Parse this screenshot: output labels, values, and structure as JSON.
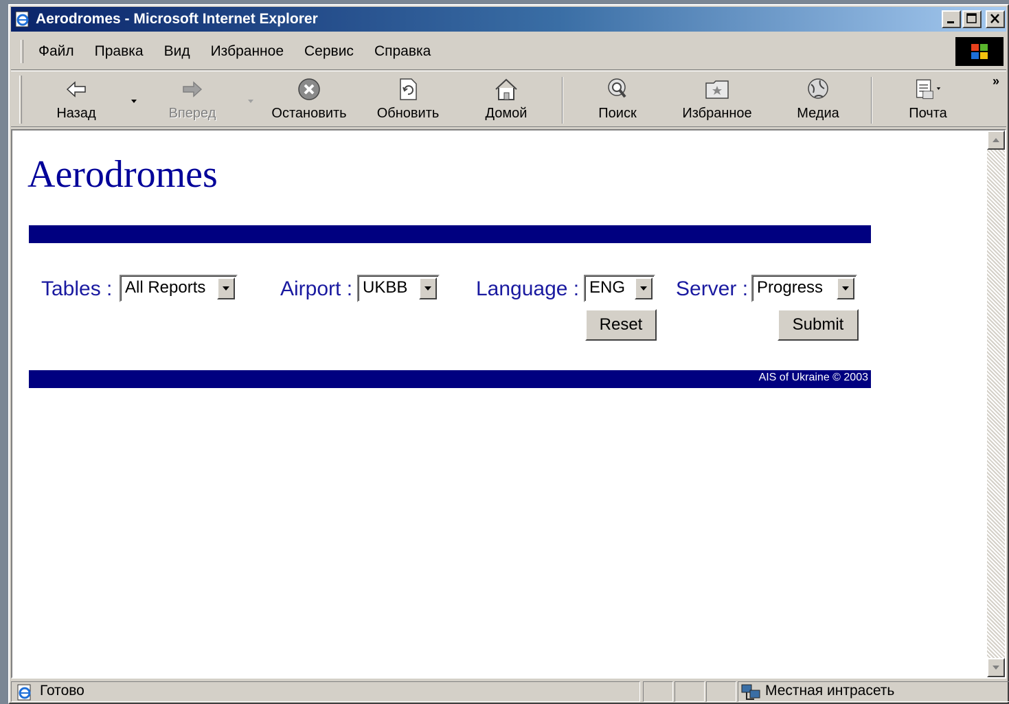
{
  "window": {
    "title": "Aerodromes - Microsoft Internet Explorer"
  },
  "menu": [
    "Файл",
    "Правка",
    "Вид",
    "Избранное",
    "Сервис",
    "Справка"
  ],
  "toolbar": {
    "back": "Назад",
    "forward": "Вперед",
    "stop": "Остановить",
    "refresh": "Обновить",
    "home": "Домой",
    "search": "Поиск",
    "favorites": "Избранное",
    "media": "Медиа",
    "mail": "Почта",
    "more": "»"
  },
  "page": {
    "title": "Aerodromes",
    "form": {
      "tables_label": "Tables :",
      "tables_value": "All Reports",
      "airport_label": "Airport :",
      "airport_value": "UKBB",
      "language_label": "Language :",
      "language_value": "ENG",
      "server_label": "Server :",
      "server_value": "Progress",
      "reset": "Reset",
      "submit": "Submit"
    },
    "footer": "AIS of Ukraine © 2003"
  },
  "status": {
    "text": "Готово",
    "zone": "Местная интрасеть"
  },
  "colors": {
    "titlebar_start": "#0a246a",
    "bar": "#000080",
    "heading": "#000099",
    "label": "#1a1aa0"
  }
}
